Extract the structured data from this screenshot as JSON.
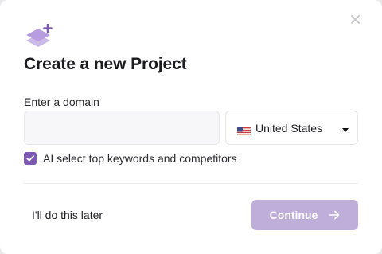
{
  "modal": {
    "title": "Create a new Project",
    "close_icon": "close-icon",
    "header_icon": "layers-add-icon"
  },
  "domain": {
    "label": "Enter a domain",
    "value": "",
    "placeholder": ""
  },
  "country": {
    "selected": "United States",
    "flag_icon": "us-flag-icon",
    "caret_icon": "caret-down-icon"
  },
  "ai_option": {
    "label": "AI select top keywords and competitors",
    "checked": true
  },
  "footer": {
    "later_label": "I'll do this later",
    "continue_label": "Continue",
    "continue_icon": "arrow-right-icon"
  },
  "colors": {
    "accent": "#7d5bb4",
    "accent_disabled": "#bfaed9",
    "icon_light": "#d6c9ec"
  }
}
